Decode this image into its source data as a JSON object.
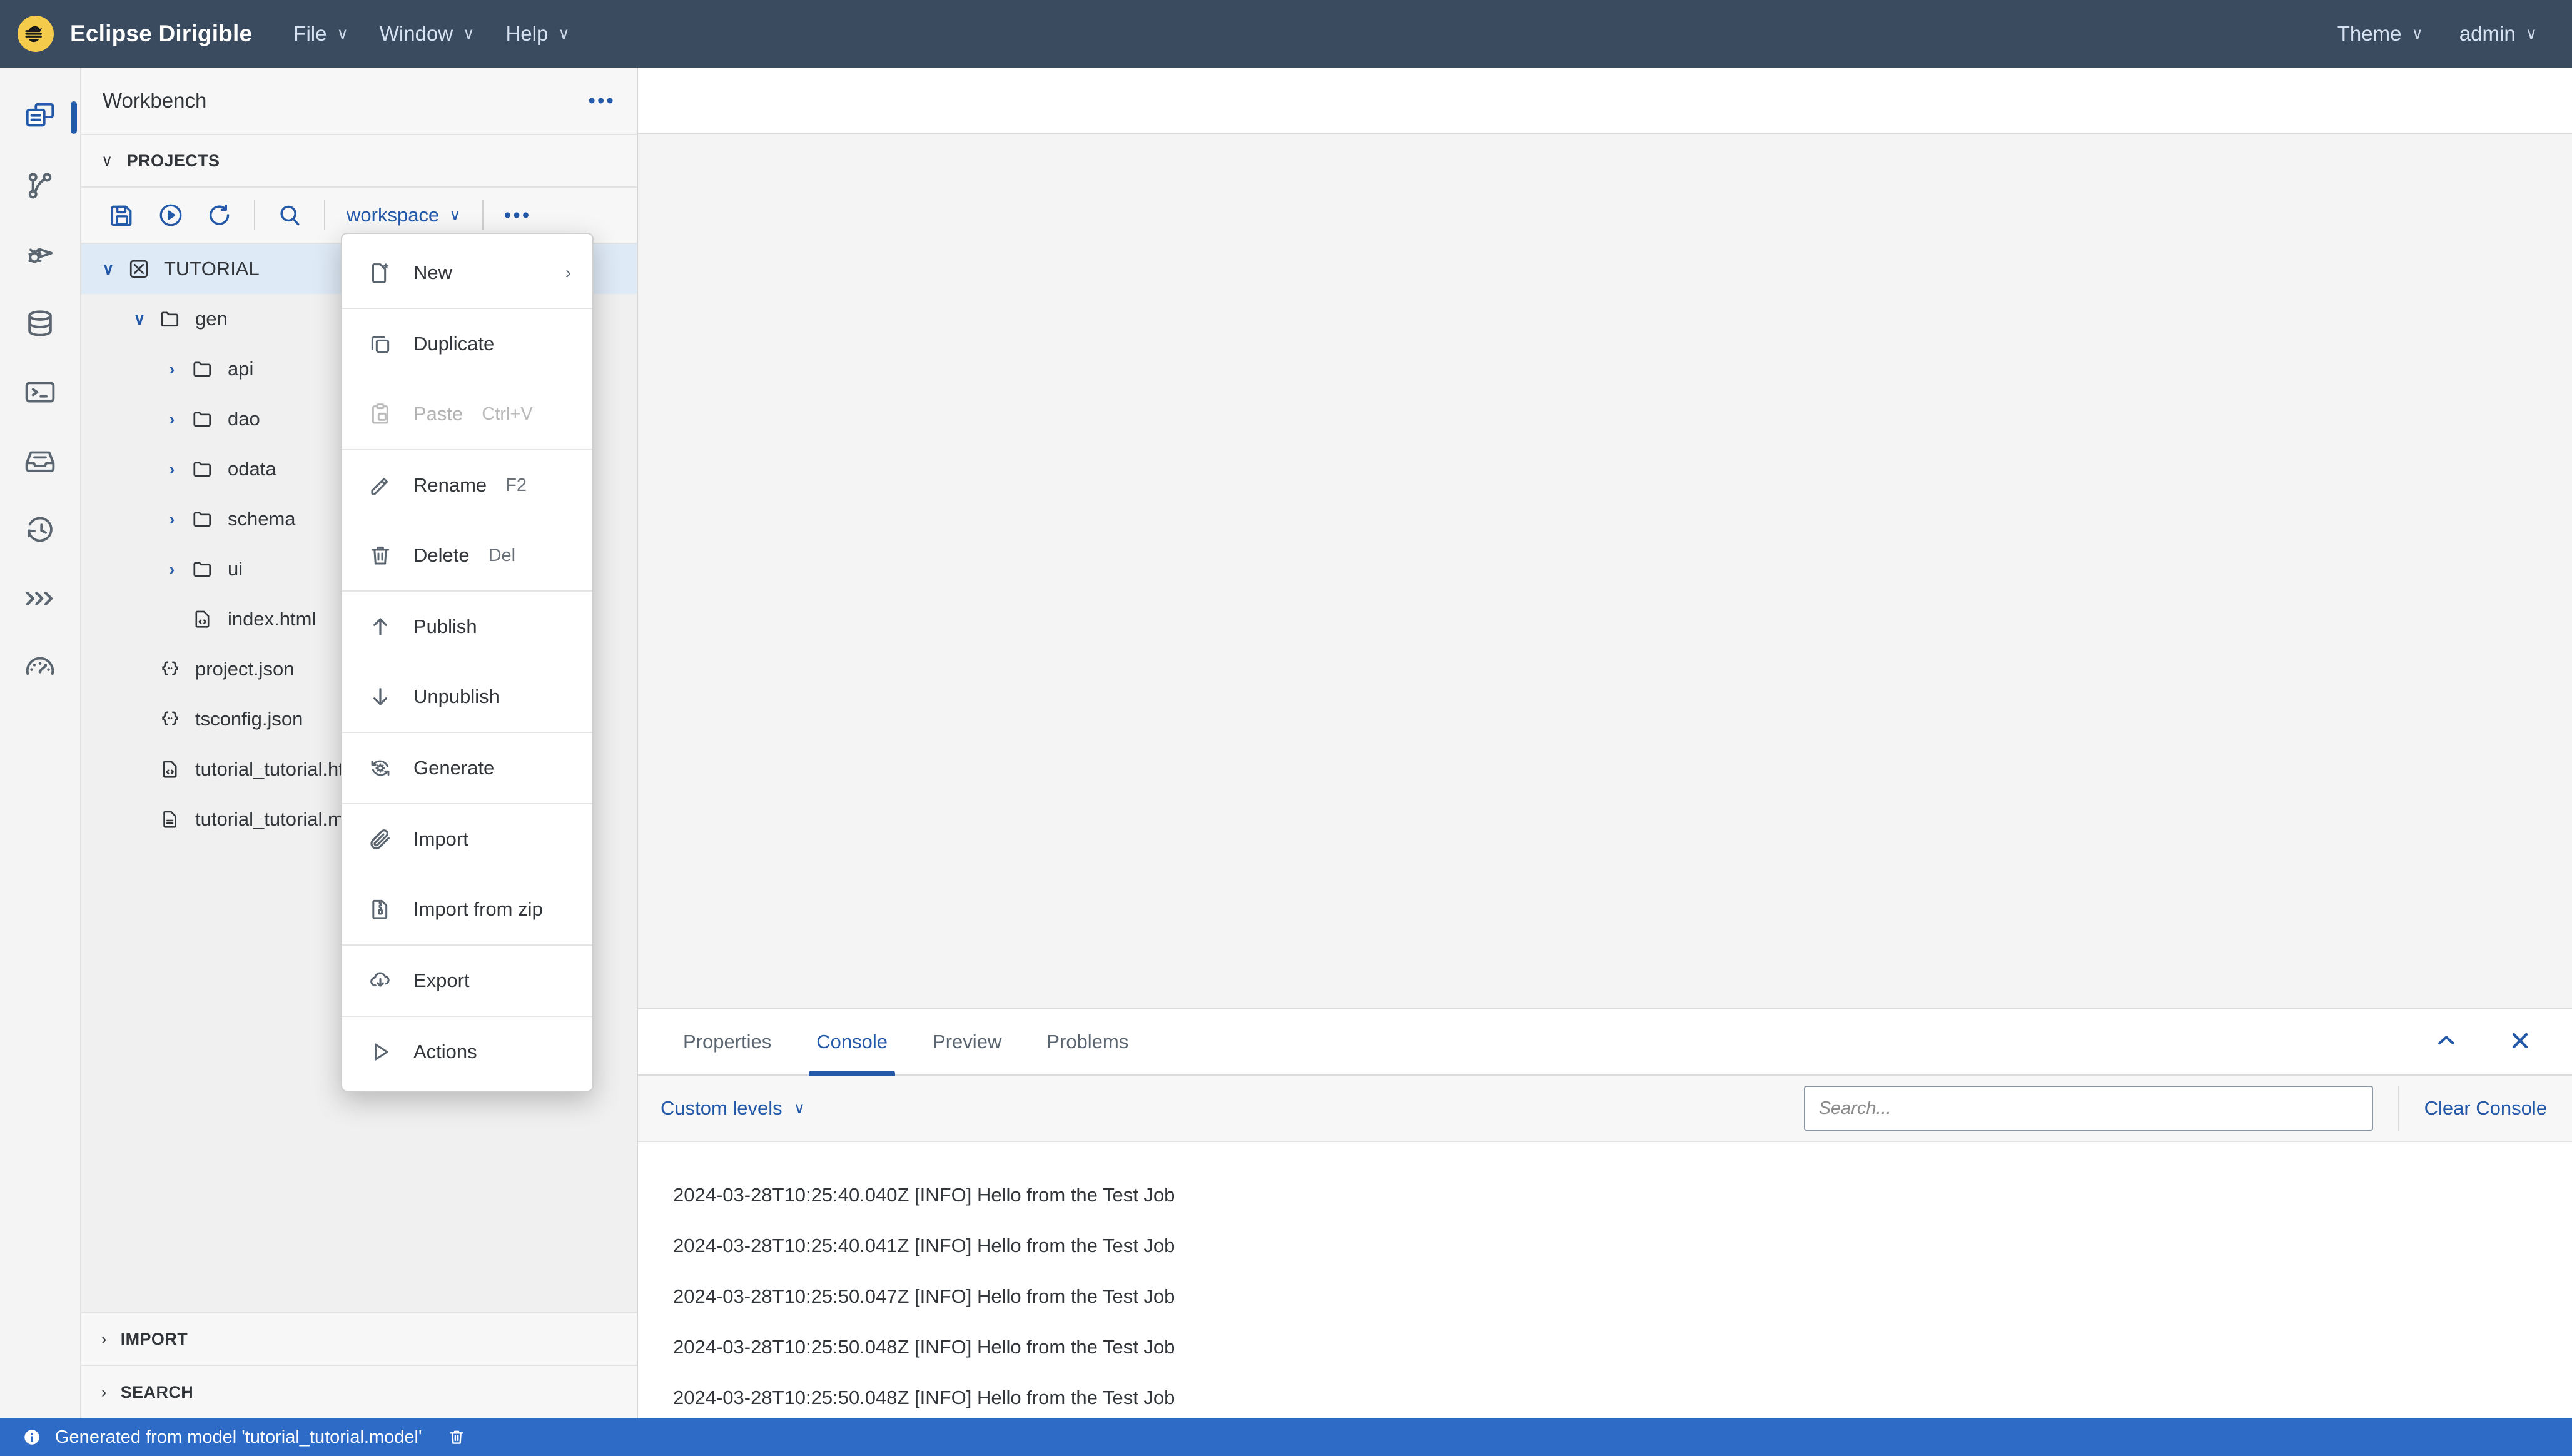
{
  "topbar": {
    "brand": "Eclipse Dirigible",
    "logo_icon": "dirigible-logo-icon",
    "menus": [
      {
        "label": "File",
        "icon": "chevron-down-icon"
      },
      {
        "label": "Window",
        "icon": "chevron-down-icon"
      },
      {
        "label": "Help",
        "icon": "chevron-down-icon"
      }
    ],
    "right_menus": [
      {
        "label": "Theme",
        "icon": "chevron-down-icon"
      },
      {
        "label": "admin",
        "icon": "chevron-down-icon"
      }
    ]
  },
  "rail": {
    "items": [
      {
        "name": "workbench-perspective",
        "icon": "workbench-icon",
        "active": true
      },
      {
        "name": "git-perspective",
        "icon": "git-branch-icon",
        "active": false
      },
      {
        "name": "debugger-perspective",
        "icon": "debug-icon",
        "active": false
      },
      {
        "name": "database-perspective",
        "icon": "database-icon",
        "active": false
      },
      {
        "name": "terminal-perspective",
        "icon": "terminal-icon",
        "active": false
      },
      {
        "name": "repository-perspective",
        "icon": "inbox-icon",
        "active": false
      },
      {
        "name": "jobs-perspective",
        "icon": "history-clock-icon",
        "active": false
      },
      {
        "name": "flow-perspective",
        "icon": "chevrons-right-icon",
        "active": false
      },
      {
        "name": "monitoring-perspective",
        "icon": "gauge-icon",
        "active": false
      }
    ]
  },
  "explorer": {
    "title": "Workbench",
    "overflow_icon": "ellipsis-icon",
    "section_projects": {
      "label": "PROJECTS",
      "caret": "chevron-down-icon",
      "expanded": true
    },
    "toolbar": {
      "save": {
        "label": "Save",
        "icon": "save-icon"
      },
      "publish": {
        "label": "Publish All",
        "icon": "play-circle-icon"
      },
      "refresh": {
        "label": "Refresh",
        "icon": "refresh-icon"
      },
      "search": {
        "label": "Search",
        "icon": "search-icon"
      },
      "workspace_select": {
        "value": "workspace",
        "icon": "chevron-down-icon"
      },
      "more": {
        "label": "More",
        "icon": "ellipsis-icon"
      }
    },
    "tree": [
      {
        "label": "TUTORIAL",
        "icon": "project-icon",
        "twisty": "chevron-down-icon",
        "depth": 0,
        "selected": true
      },
      {
        "label": "gen",
        "icon": "folder-icon",
        "twisty": "chevron-down-icon",
        "depth": 1,
        "selected": false
      },
      {
        "label": "api",
        "icon": "folder-icon",
        "twisty": "chevron-right-icon",
        "depth": 2,
        "selected": false
      },
      {
        "label": "dao",
        "icon": "folder-icon",
        "twisty": "chevron-right-icon",
        "depth": 2,
        "selected": false
      },
      {
        "label": "odata",
        "icon": "folder-icon",
        "twisty": "chevron-right-icon",
        "depth": 2,
        "selected": false
      },
      {
        "label": "schema",
        "icon": "folder-icon",
        "twisty": "chevron-right-icon",
        "depth": 2,
        "selected": false
      },
      {
        "label": "ui",
        "icon": "folder-icon",
        "twisty": "chevron-right-icon",
        "depth": 2,
        "selected": false
      },
      {
        "label": "index.html",
        "icon": "html-file-icon",
        "twisty": "",
        "depth": 2,
        "selected": false
      },
      {
        "label": "project.json",
        "icon": "json-file-icon",
        "twisty": "",
        "depth": 1,
        "selected": false
      },
      {
        "label": "tsconfig.json",
        "icon": "json-file-icon",
        "twisty": "",
        "depth": 1,
        "selected": false
      },
      {
        "label": "tutorial_tutorial.html",
        "icon": "html-file-icon",
        "twisty": "",
        "depth": 1,
        "selected": false
      },
      {
        "label": "tutorial_tutorial.model",
        "icon": "model-file-icon",
        "twisty": "",
        "depth": 1,
        "selected": false
      }
    ],
    "section_import": {
      "label": "IMPORT",
      "caret": "chevron-right-icon",
      "expanded": false
    },
    "section_search": {
      "label": "SEARCH",
      "caret": "chevron-right-icon",
      "expanded": false
    }
  },
  "context_menu": {
    "groups": [
      [
        {
          "label": "New",
          "icon": "new-file-icon",
          "shortcut": "",
          "submenu": true,
          "disabled": false
        }
      ],
      [
        {
          "label": "Duplicate",
          "icon": "copy-icon",
          "shortcut": "",
          "submenu": false,
          "disabled": false
        },
        {
          "label": "Paste",
          "icon": "paste-icon",
          "shortcut": "Ctrl+V",
          "submenu": false,
          "disabled": true
        }
      ],
      [
        {
          "label": "Rename",
          "icon": "pencil-icon",
          "shortcut": "F2",
          "submenu": false,
          "disabled": false
        },
        {
          "label": "Delete",
          "icon": "trash-icon",
          "shortcut": "Del",
          "submenu": false,
          "disabled": false
        }
      ],
      [
        {
          "label": "Publish",
          "icon": "arrow-up-icon",
          "shortcut": "",
          "submenu": false,
          "disabled": false
        },
        {
          "label": "Unpublish",
          "icon": "arrow-down-icon",
          "shortcut": "",
          "submenu": false,
          "disabled": false
        }
      ],
      [
        {
          "label": "Generate",
          "icon": "generate-gear-icon",
          "shortcut": "",
          "submenu": false,
          "disabled": false
        }
      ],
      [
        {
          "label": "Import",
          "icon": "paperclip-icon",
          "shortcut": "",
          "submenu": false,
          "disabled": false
        },
        {
          "label": "Import from zip",
          "icon": "zip-file-icon",
          "shortcut": "",
          "submenu": false,
          "disabled": false
        }
      ],
      [
        {
          "label": "Export",
          "icon": "cloud-download-icon",
          "shortcut": "",
          "submenu": false,
          "disabled": false
        }
      ],
      [
        {
          "label": "Actions",
          "icon": "play-triangle-icon",
          "shortcut": "",
          "submenu": false,
          "disabled": false
        }
      ]
    ]
  },
  "bottom_panel": {
    "tabs": [
      {
        "label": "Properties",
        "active": false
      },
      {
        "label": "Console",
        "active": true
      },
      {
        "label": "Preview",
        "active": false
      },
      {
        "label": "Problems",
        "active": false
      }
    ],
    "maximize_icon": "chevron-up-icon",
    "close_icon": "close-icon",
    "console": {
      "levels_label": "Custom levels",
      "levels_caret": "chevron-down-icon",
      "search_placeholder": "Search...",
      "search_value": "",
      "clear_label": "Clear Console",
      "lines": [
        "2024-03-28T10:25:40.040Z [INFO] Hello from the Test Job",
        "2024-03-28T10:25:40.041Z [INFO] Hello from the Test Job",
        "2024-03-28T10:25:50.047Z [INFO] Hello from the Test Job",
        "2024-03-28T10:25:50.048Z [INFO] Hello from the Test Job",
        "2024-03-28T10:25:50.048Z [INFO] Hello from the Test Job"
      ]
    }
  },
  "statusbar": {
    "info_icon": "info-circle-icon",
    "message": "Generated from model 'tutorial_tutorial.model'",
    "clear_icon": "trash-icon"
  },
  "colors": {
    "topbar_bg": "#3a4a5f",
    "accent_blue": "#2359a8",
    "status_bg": "#2e6bc6",
    "logo_yellow": "#f5cb4b",
    "selection_bg": "#dfeaf7"
  }
}
